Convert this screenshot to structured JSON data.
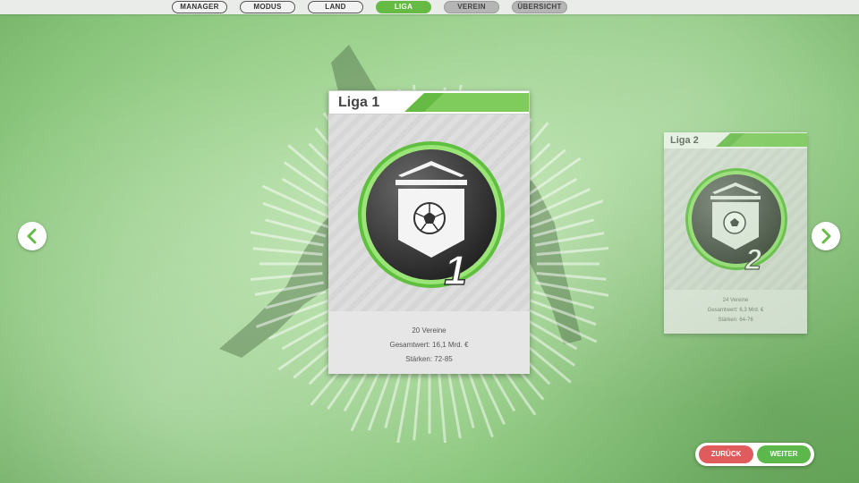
{
  "nav": {
    "tabs": [
      {
        "label": "MANAGER",
        "state": "completed"
      },
      {
        "label": "MODUS",
        "state": "completed"
      },
      {
        "label": "LAND",
        "state": "completed"
      },
      {
        "label": "LIGA",
        "state": "active"
      },
      {
        "label": "VEREIN",
        "state": "upcoming"
      },
      {
        "label": "ÜBERSICHT",
        "state": "upcoming"
      }
    ]
  },
  "carousel": {
    "prev_icon": "chevron-left-icon",
    "next_icon": "chevron-right-icon"
  },
  "leagues": [
    {
      "title": "Liga 1",
      "emblem_number": "1",
      "clubs": "20 Vereine",
      "total_value": "Gesamtwert: 16,1 Mrd. €",
      "strengths": "Stärken: 72-85"
    },
    {
      "title": "Liga 2",
      "emblem_number": "2",
      "clubs": "24 Vereine",
      "total_value": "Gesamtwert: 6,3 Mrd. €",
      "strengths": "Stärken: 64-76"
    }
  ],
  "footer": {
    "back_label": "ZURÜCK",
    "next_label": "WEITER"
  },
  "colors": {
    "accent": "#66bb44",
    "back": "#e05c5c",
    "next": "#5cb84a",
    "emblem_ring": "#8ee06a"
  }
}
